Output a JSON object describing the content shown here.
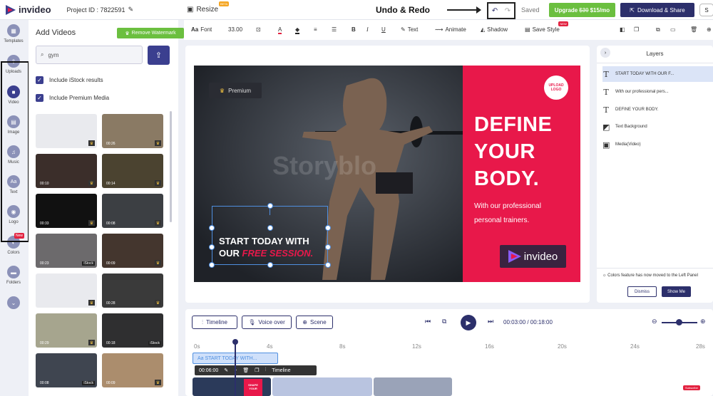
{
  "topbar": {
    "brand": "invideo",
    "project_id": "Project ID : 7822591",
    "resize": "Resize",
    "beta": "BETA",
    "annotation": "Undo & Redo",
    "saved": "Saved",
    "upgrade_prefix": "Upgrade",
    "upgrade_old_price": "$30",
    "upgrade_price": "$15/mo",
    "download": "Download & Share",
    "avatar": "S"
  },
  "rail": {
    "items": [
      {
        "label": "Templates",
        "icon": "grid-icon"
      },
      {
        "label": "Uploads",
        "icon": "upload-icon"
      },
      {
        "label": "Video",
        "icon": "video-icon"
      },
      {
        "label": "Image",
        "icon": "image-icon"
      },
      {
        "label": "Music",
        "icon": "music-icon"
      },
      {
        "label": "Text",
        "icon": "text-icon"
      },
      {
        "label": "Logo",
        "icon": "logo-icon"
      },
      {
        "label": "Colors",
        "icon": "palette-icon"
      },
      {
        "label": "Folders",
        "icon": "folder-icon"
      }
    ],
    "new_badge": "New"
  },
  "panel": {
    "title": "Add Videos",
    "remove_watermark": "Remove Watermark",
    "search_value": "gym",
    "istock": "Include iStock results",
    "premium": "Include Premium Media",
    "thumbs": [
      {
        "dur": "",
        "badge": "prem",
        "color": "#e9eaee"
      },
      {
        "dur": "00:26",
        "badge": "prem",
        "color": "#8a7a64"
      },
      {
        "dur": "00:10",
        "badge": "prem",
        "color": "#3b2e2a"
      },
      {
        "dur": "00:14",
        "badge": "prem",
        "color": "#4b4330"
      },
      {
        "dur": "00:33",
        "badge": "prem",
        "color": "#111111"
      },
      {
        "dur": "00:08",
        "badge": "prem",
        "color": "#3c3f43"
      },
      {
        "dur": "00:23",
        "badge": "iStock",
        "color": "#6c6a6c"
      },
      {
        "dur": "00:09",
        "badge": "prem",
        "color": "#44362e"
      },
      {
        "dur": "",
        "badge": "prem",
        "color": "#e9eaee"
      },
      {
        "dur": "00:28",
        "badge": "prem",
        "color": "#3a3a3a"
      },
      {
        "dur": "00:29",
        "badge": "prem",
        "color": "#a6a58e"
      },
      {
        "dur": "00:18",
        "badge": "iStock",
        "color": "#2f2f30"
      },
      {
        "dur": "00:08",
        "badge": "iStock",
        "color": "#3f4550"
      },
      {
        "dur": "00:09",
        "badge": "prem",
        "color": "#ab8d6d"
      }
    ]
  },
  "toolbar": {
    "font": "Font",
    "size": "33.00",
    "text": "Text",
    "animate": "Animate",
    "shadow": "Shadow",
    "save_style": "Save Style",
    "new": "NEW"
  },
  "canvas": {
    "premium": "Premium",
    "watermark": "Storyblo",
    "headline": [
      "DEFINE",
      "YOUR",
      "BODY."
    ],
    "sub": [
      "With our professional",
      "personal trainers."
    ],
    "brand": "invideo",
    "upload_logo": "UPLOAD LOGO",
    "start_line1": "START TODAY WITH",
    "start_line2_a": "OUR ",
    "start_line2_b": "FREE SESSION."
  },
  "layers": {
    "title": "Layers",
    "items": [
      {
        "label": "START TODAY WITH OUR F...",
        "icon": "T"
      },
      {
        "label": "With our professional pers...",
        "icon": "T"
      },
      {
        "label": "DEFINE YOUR BODY.",
        "icon": "T"
      },
      {
        "label": "Text Background",
        "icon": "◩"
      },
      {
        "label": "Media(Video)",
        "icon": "▣"
      }
    ],
    "notice": "Colors feature has now moved to the Left Panel",
    "dismiss": "Dismiss",
    "show_me": "Show Me"
  },
  "timeline": {
    "timeline": "Timeline",
    "voice_over": "Voice over",
    "scene": "Scene",
    "time": "00:03:00 / 00:18:00",
    "ticks": [
      "0s",
      "4s",
      "8s",
      "12s",
      "16s",
      "20s",
      "24s",
      "28s"
    ],
    "text_clip": "Aa START TODAY WITH...",
    "clip_time": "00:06:00",
    "clip_timeline": "Timeline",
    "subscribe": "Subscribe"
  },
  "colors": {
    "accent": "#2c2f6b",
    "green": "#6bbf3f",
    "red": "#e8184a",
    "select": "#4f8fe0"
  }
}
